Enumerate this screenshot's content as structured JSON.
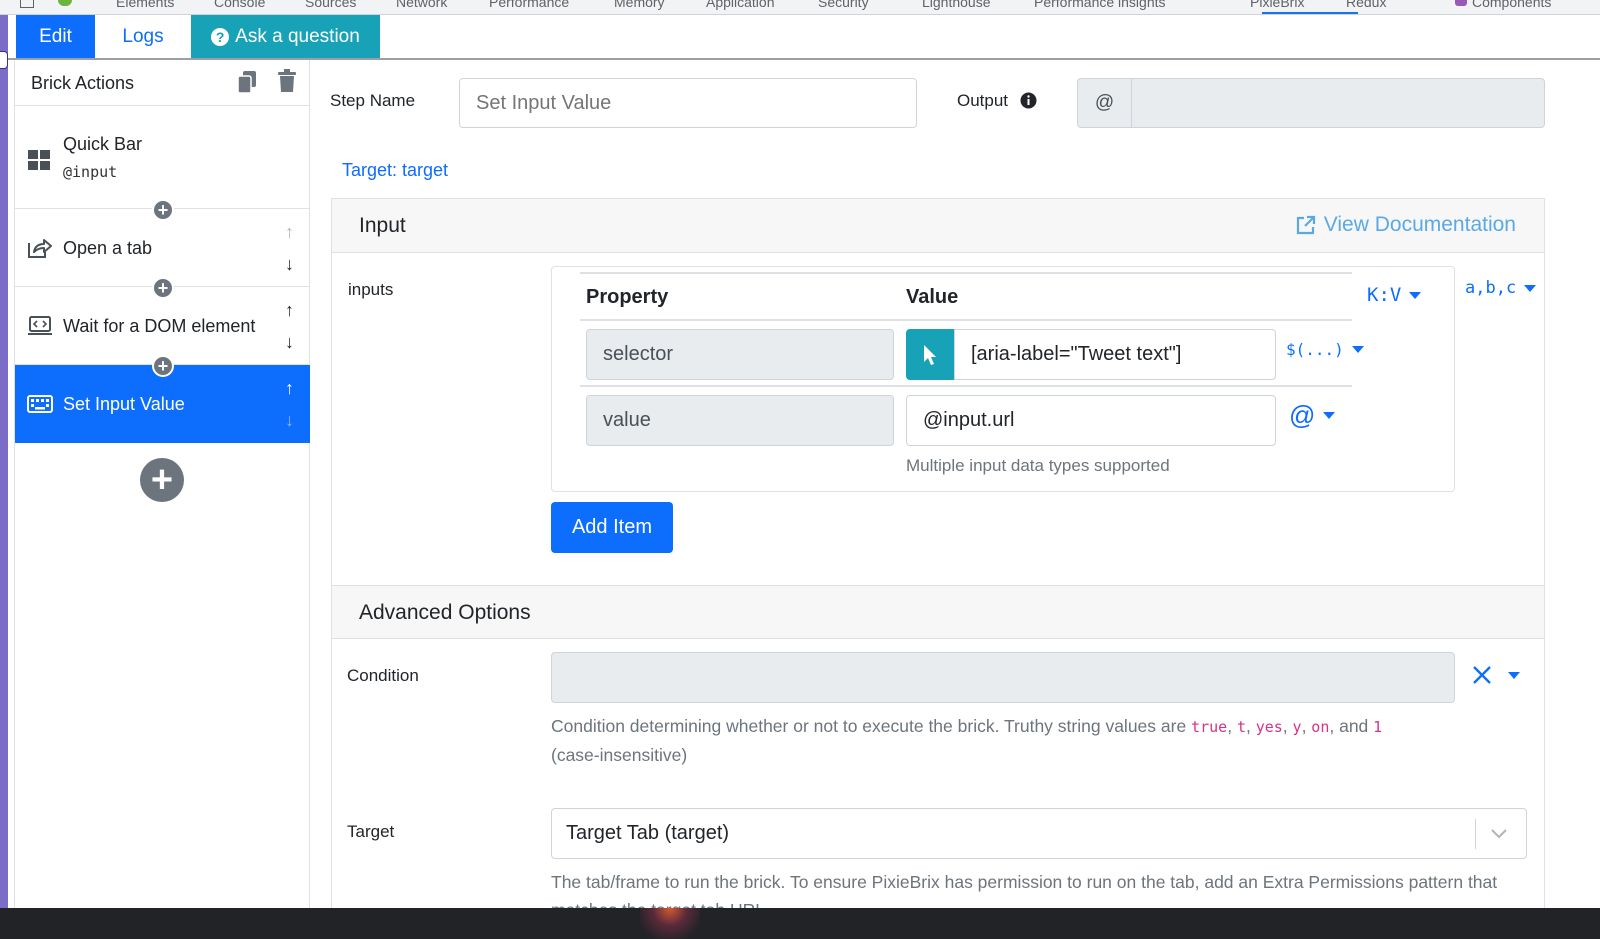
{
  "devtools": {
    "tabs": [
      "Elements",
      "Console",
      "Sources",
      "Network",
      "Performance",
      "Memory",
      "Application",
      "Security",
      "Lighthouse",
      "Performance insights",
      "PixieBrix",
      "Redux",
      "Components"
    ],
    "active_tab": "PixieBrix"
  },
  "topnav": {
    "edit": "Edit",
    "logs": "Logs",
    "ask": "Ask a question"
  },
  "sidebar": {
    "title": "Brick Actions",
    "blocks": [
      {
        "name": "Quick Bar",
        "sub": "@input",
        "icon": "grid-icon"
      },
      {
        "name": "Open a tab",
        "icon": "share-icon"
      },
      {
        "name": "Wait for a DOM element",
        "icon": "laptop-code-icon"
      },
      {
        "name": "Set Input Value",
        "icon": "keyboard-icon",
        "active": true
      }
    ]
  },
  "main": {
    "step_name_label": "Step Name",
    "step_name_placeholder": "Set Input Value",
    "output_label": "Output",
    "output_prefix": "@",
    "target_link": "Target: target",
    "input_card": {
      "title": "Input",
      "view_docs": "View Documentation",
      "field_label": "inputs",
      "col_property": "Property",
      "col_value": "Value",
      "kv_toggle": "K:V",
      "abc_toggle": "a,b,c",
      "rows": [
        {
          "property": "selector",
          "value": "[aria-label=\"Tweet text\"]",
          "toggle": "$(...)"
        },
        {
          "property": "value",
          "value": "@input.url",
          "toggle": "@"
        }
      ],
      "value_help": "Multiple input data types supported",
      "add_item": "Add Item"
    },
    "advanced": {
      "title": "Advanced Options",
      "condition_label": "Condition",
      "condition_help_prefix": "Condition determining whether or not to execute the brick. Truthy string values are",
      "truthy_values": [
        "true",
        "t",
        "yes",
        "y",
        "on",
        "1"
      ],
      "condition_help_and": "and",
      "condition_help_suffix": "(case-insensitive)",
      "target_label": "Target",
      "target_value": "Target Tab (target)",
      "target_help": "The tab/frame to run the brick. To ensure PixieBrix has permission to run on the tab, add an Extra Permissions pattern that matches the target tab URL"
    }
  },
  "colors": {
    "primary": "#0d6efd",
    "info": "#17a2b8",
    "code_pink": "#d63384"
  }
}
